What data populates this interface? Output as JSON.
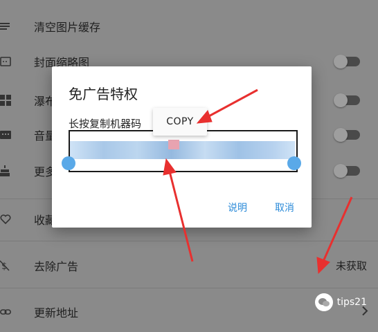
{
  "settings": {
    "items": [
      {
        "label": "清空图片缓存",
        "icon": "menu-lines-icon"
      },
      {
        "label": "封面缩略图",
        "icon": "image-icon",
        "control": "toggle",
        "on": false
      },
      {
        "label": "瀑布",
        "icon": "grid-icon",
        "control": "toggle",
        "on": false
      },
      {
        "label": "音量",
        "icon": "keyboard-icon",
        "control": "toggle",
        "on": false
      },
      {
        "label": "更多",
        "icon": "cake-icon",
        "control": "toggle",
        "on": false
      },
      {
        "label": "收藏",
        "icon": "heart-icon"
      },
      {
        "label": "去除广告",
        "icon": "no-money-icon",
        "value": "未获取"
      },
      {
        "label": "更新地址",
        "icon": "link-icon"
      }
    ]
  },
  "dialog": {
    "title": "免广告特权",
    "field_label": "长按复制机器码",
    "copy_label": "COPY",
    "buttons": {
      "explain": "说明",
      "cancel": "取消"
    }
  },
  "watermark": {
    "text": "tips21",
    "icon": "wechat-icon"
  },
  "colors": {
    "accent": "#2a8ad8",
    "overlay": "#8a8a8a",
    "arrow": "#e8302f",
    "selection": "#a9c8e8"
  }
}
